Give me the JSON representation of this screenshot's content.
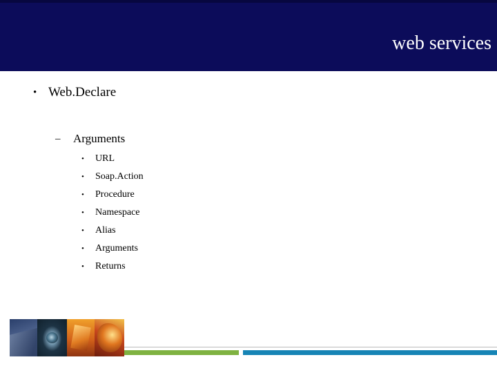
{
  "header": {
    "title": "web services"
  },
  "content": {
    "level1": {
      "bullet": "•",
      "text": "Web.Declare"
    },
    "level2": {
      "bullet": "–",
      "text": "Arguments"
    },
    "level3": {
      "bullet": "•",
      "items": [
        "URL",
        "Soap.Action",
        "Procedure",
        "Namespace",
        "Alias",
        "Arguments",
        "Returns"
      ]
    }
  },
  "footer": {
    "photos": [
      "photo-abstract-blue",
      "photo-eye",
      "photo-orange-abstract",
      "photo-fruit-warm"
    ]
  },
  "colors": {
    "header_band": "#0c0c5a",
    "accent_green": "#7fb241",
    "accent_blue": "#1684b5",
    "rule_grey": "#b9b9b9",
    "text": "#000000"
  }
}
